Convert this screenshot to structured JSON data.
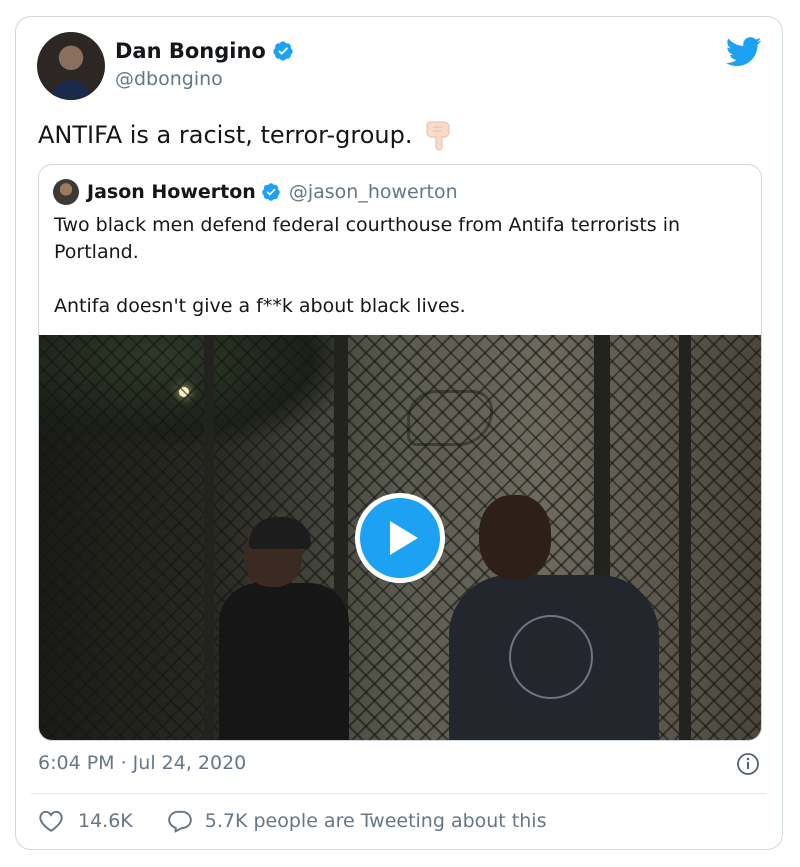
{
  "author": {
    "display_name": "Dan Bongino",
    "handle": "@dbongino",
    "verified": true
  },
  "tweet": {
    "text": "ANTIFA is a racist, terror-group.",
    "emoji": "backhand-index-pointing-down"
  },
  "quoted_tweet": {
    "display_name": "Jason Howerton",
    "handle": "@jason_howerton",
    "verified": true,
    "text_line1": "Two black men defend federal courthouse from Antifa terrorists in Portland.",
    "text_line2": "Antifa doesn't give a f**k about black lives.",
    "media": {
      "type": "video",
      "play_icon": "play-icon"
    }
  },
  "meta": {
    "timestamp": "6:04 PM · Jul 24, 2020",
    "info_icon": "info-icon"
  },
  "actions": {
    "like_count": "14.6K",
    "tweeting_text": "5.7K people are Tweeting about this"
  },
  "colors": {
    "twitter_blue": "#1da1f2",
    "secondary_text": "#657786",
    "border": "#cfd9de"
  }
}
